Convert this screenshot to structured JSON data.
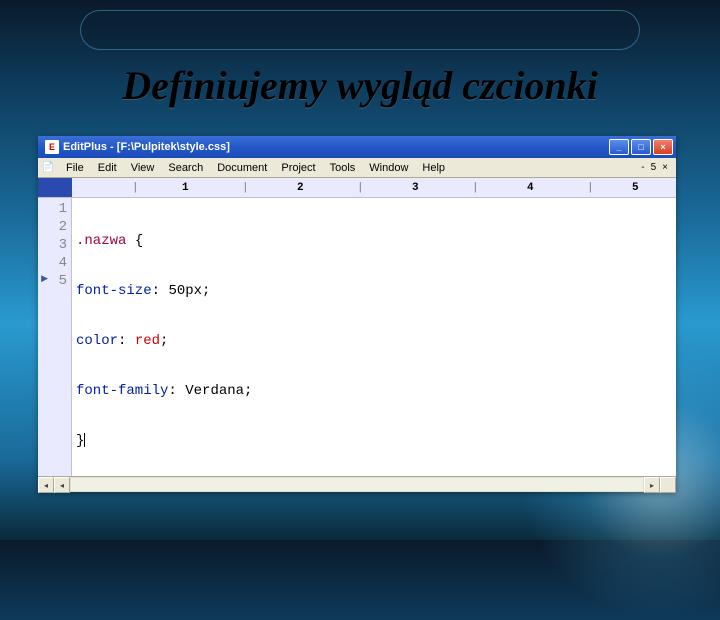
{
  "slide_title": "Definiujemy wygląd czcionki",
  "window": {
    "title": "EditPlus - [F:\\Pulpitek\\style.css]",
    "app_icon_text": "E"
  },
  "menu": {
    "items": [
      "File",
      "Edit",
      "View",
      "Search",
      "Document",
      "Project",
      "Tools",
      "Window",
      "Help"
    ]
  },
  "mdi": {
    "label": "5"
  },
  "ruler": {
    "cols": [
      "1",
      "2",
      "3",
      "4",
      "5"
    ]
  },
  "gutter": {
    "lines": [
      "1",
      "2",
      "3",
      "4",
      "5"
    ]
  },
  "code": {
    "l1_sel": ".nazwa",
    "l1_brace": " {",
    "l2_prop": "font-size",
    "l2_colon": ": ",
    "l2_val": "50px",
    "l2_semi": ";",
    "l3_prop": "color",
    "l3_colon": ": ",
    "l3_val": "red",
    "l3_semi": ";",
    "l4_prop": "font-family",
    "l4_colon": ": ",
    "l4_val": "Verdana",
    "l4_semi": ";",
    "l5_brace": "}"
  },
  "win_controls": {
    "min": "_",
    "max": "□",
    "close": "×"
  },
  "mdi_controls": {
    "min": "-",
    "restore": "❐",
    "close": "×"
  }
}
